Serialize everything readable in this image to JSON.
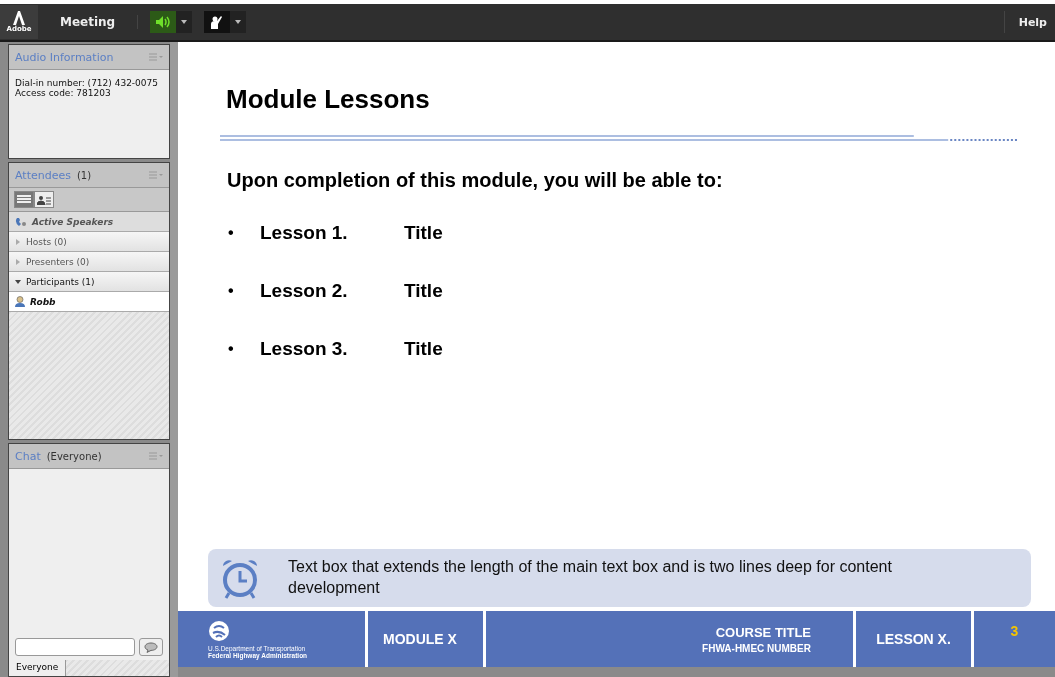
{
  "top_bar": {
    "logo": "Adobe",
    "menu": "Meeting",
    "help": "Help",
    "audio_on": true
  },
  "audio_panel": {
    "title": "Audio Information",
    "lines": [
      "Dial-in number: (712) 432-0075",
      "Access code: 781203"
    ]
  },
  "attendees_panel": {
    "title": "Attendees",
    "count": "(1)",
    "views": [
      {
        "kind": "list",
        "selected": true
      },
      {
        "kind": "cards",
        "selected": false
      }
    ],
    "active_speakers": "Active Speakers",
    "groups": [
      {
        "label": "Hosts (0)",
        "expanded": false
      },
      {
        "label": "Presenters (0)",
        "expanded": false
      },
      {
        "label": "Participants (1)",
        "expanded": true,
        "children": [
          {
            "name": "Robb"
          }
        ]
      }
    ]
  },
  "chat_panel": {
    "title": "Chat",
    "scope": "(Everyone)",
    "tab": "Everyone"
  },
  "slide": {
    "title": "Module Lessons",
    "intro": "Upon completion of this module, you will be able to:",
    "lessons": [
      {
        "bullet": "•",
        "lesson": "Lesson 1.",
        "title": "Title"
      },
      {
        "bullet": "•",
        "lesson": "Lesson 2.",
        "title": "Title"
      },
      {
        "bullet": "•",
        "lesson": "Lesson 3.",
        "title": "Title"
      }
    ],
    "callout": "Text box that extends the length of the main text box and is two lines deep for content development",
    "footer": {
      "agency_line1": "U.S.Department of Transportation",
      "agency_line2": "Federal Highway Administration",
      "module": "MODULE X",
      "course": "COURSE TITLE",
      "course_number": "FHWA-HMEC NUMBER",
      "lesson": "LESSON X.",
      "page": "3"
    }
  }
}
